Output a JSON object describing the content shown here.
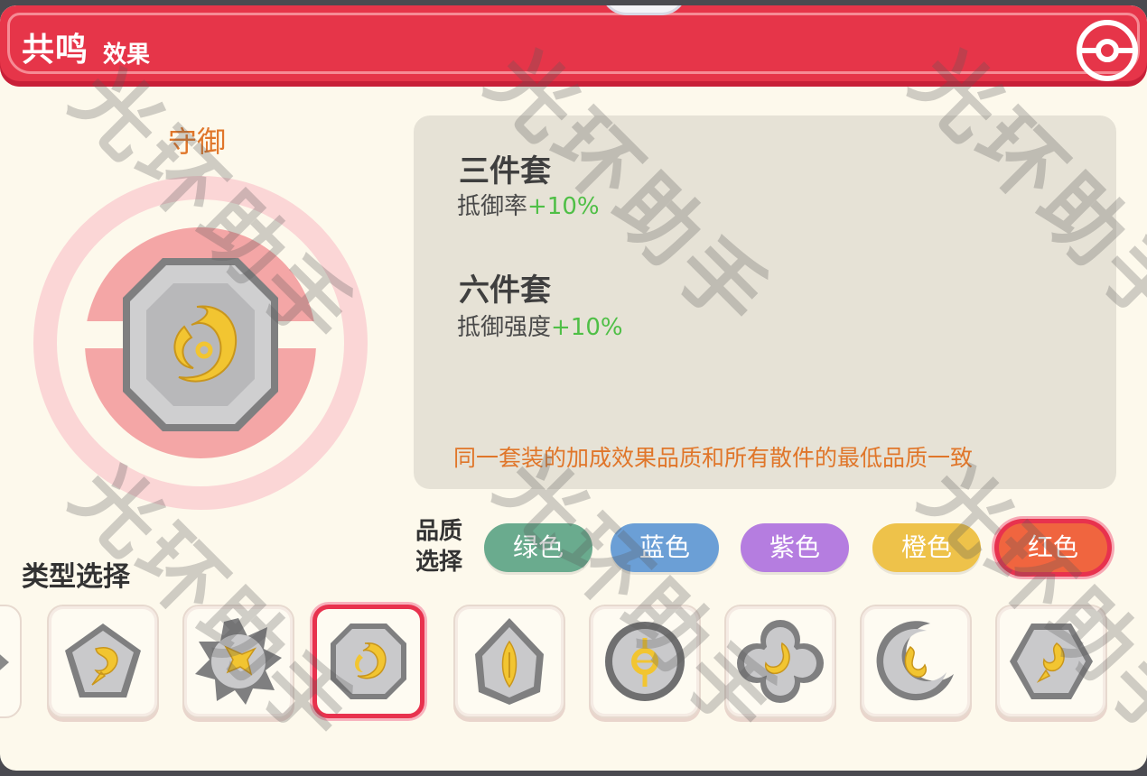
{
  "header": {
    "title_main": "共鸣",
    "title_sub": "效果"
  },
  "set": {
    "name": "守御"
  },
  "info": {
    "three_piece_title": "三件套",
    "three_piece_stat": "抵御率",
    "three_piece_bonus": "+10%",
    "six_piece_title": "六件套",
    "six_piece_stat": "抵御强度",
    "six_piece_bonus": "+10%",
    "note": "同一套装的加成效果品质和所有散件的最低品质一致"
  },
  "quality": {
    "label_line1": "品质",
    "label_line2": "选择",
    "options": [
      {
        "label": "绿色",
        "color": "#6aab8e"
      },
      {
        "label": "蓝色",
        "color": "#6b9fd6"
      },
      {
        "label": "紫色",
        "color": "#b57de0"
      },
      {
        "label": "橙色",
        "color": "#eec24a"
      },
      {
        "label": "红色",
        "color": "#f0653f",
        "selected": true
      }
    ]
  },
  "type_select": {
    "label": "类型选择",
    "selected_index": 2,
    "icons": [
      "pentagon-emblem-icon",
      "spiky-star-emblem-icon",
      "octagon-emblem-icon",
      "drop-shield-emblem-icon",
      "circle-eye-emblem-icon",
      "cloud-emblem-icon",
      "crescent-moon-emblem-icon",
      "hexagon-emblem-icon"
    ]
  },
  "watermark": "光环助手",
  "colors": {
    "header_red": "#e63549",
    "accent_orange": "#e0762a",
    "bonus_green": "#4fbf46",
    "gold": "#f2c531"
  }
}
